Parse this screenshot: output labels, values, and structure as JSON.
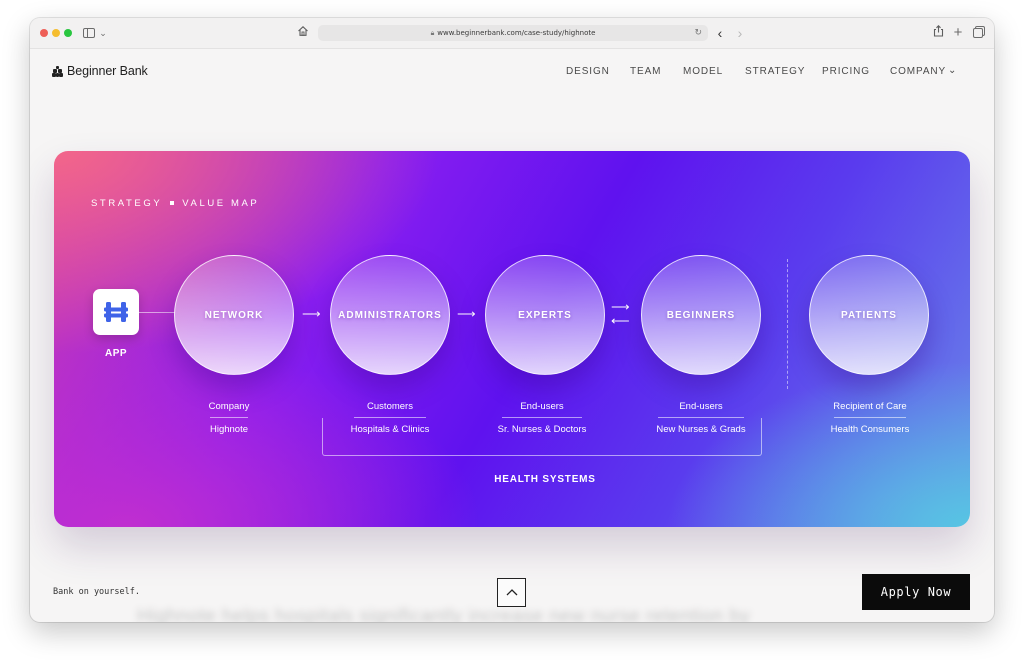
{
  "browser": {
    "url": "www.beginnerbank.com/case-study/highnote"
  },
  "site": {
    "brand": "Beginner Bank",
    "nav": [
      "DESIGN",
      "TEAM",
      "MODEL",
      "STRATEGY",
      "PRICING",
      "COMPANY"
    ]
  },
  "hero": {
    "eyebrow_left": "STRATEGY",
    "eyebrow_right": "VALUE MAP",
    "app_label": "APP",
    "nodes": [
      {
        "label": "NETWORK",
        "top": "Company",
        "bottom": "Highnote"
      },
      {
        "label": "ADMINISTRATORS",
        "top": "Customers",
        "bottom": "Hospitals & Clinics"
      },
      {
        "label": "EXPERTS",
        "top": "End-users",
        "bottom": "Sr. Nurses & Doctors"
      },
      {
        "label": "BEGINNERS",
        "top": "End-users",
        "bottom": "New Nurses & Grads"
      },
      {
        "label": "PATIENTS",
        "top": "Recipient of Care",
        "bottom": "Health Consumers"
      }
    ],
    "group_label": "HEALTH SYSTEMS"
  },
  "footer": {
    "tagline": "Bank on yourself.",
    "apply_label": "Apply Now",
    "obscured_text": "Highnote helps hospitals significantly increase new nurse retention by"
  },
  "colors": {
    "gradient_start": "#f2668a",
    "gradient_mid": "#5f12ef",
    "gradient_end": "#57c5e3",
    "apply_bg": "#0b0b0b"
  }
}
